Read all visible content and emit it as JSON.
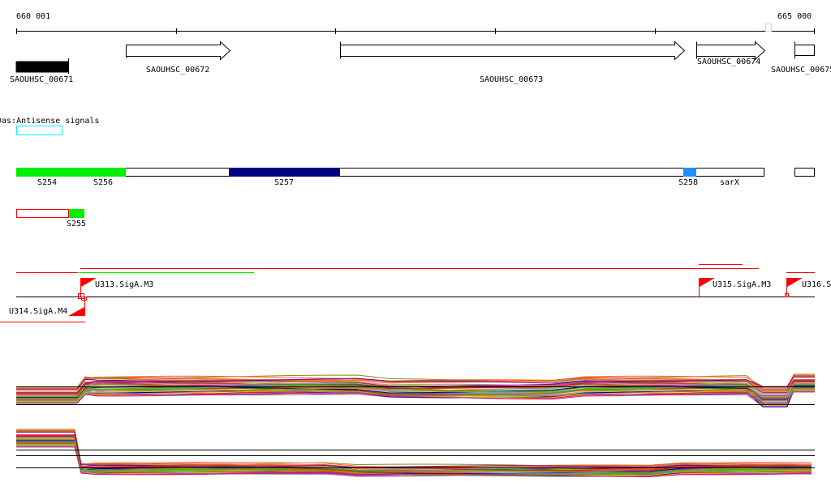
{
  "ruler": {
    "start_label": "660 001",
    "end_label": "665 000"
  },
  "genes": [
    {
      "name": "SAOUHSC_00671",
      "strand": "none"
    },
    {
      "name": "SAOUHSC_00672",
      "strand": "+"
    },
    {
      "name": "SAOUHSC_00673",
      "strand": "+"
    },
    {
      "name": "SAOUHSC_00674",
      "strand": "+"
    },
    {
      "name": "SAOUHSC_00675",
      "strand": "+"
    }
  ],
  "antisense_track": {
    "label": "Das:Antisense signals"
  },
  "segments": [
    {
      "label": "S254",
      "color": "#00ee00"
    },
    {
      "label": "S256",
      "color": "#ffffff"
    },
    {
      "label": "S257",
      "color": "#000080"
    },
    {
      "label": "S258",
      "color": "#1e90ff"
    },
    {
      "label": "sarX",
      "color": "#ffffff"
    },
    {
      "label": "S255",
      "color": "#00ee00"
    }
  ],
  "promoters": [
    {
      "label": "U313.SigA.M3"
    },
    {
      "label": "U314.SigA.M4"
    },
    {
      "label": "U315.SigA.M3"
    },
    {
      "label": "U316.S"
    }
  ],
  "colors": {
    "red": "#ff0000",
    "green": "#00ee00",
    "cyan": "#00ffff",
    "navy": "#000080"
  }
}
